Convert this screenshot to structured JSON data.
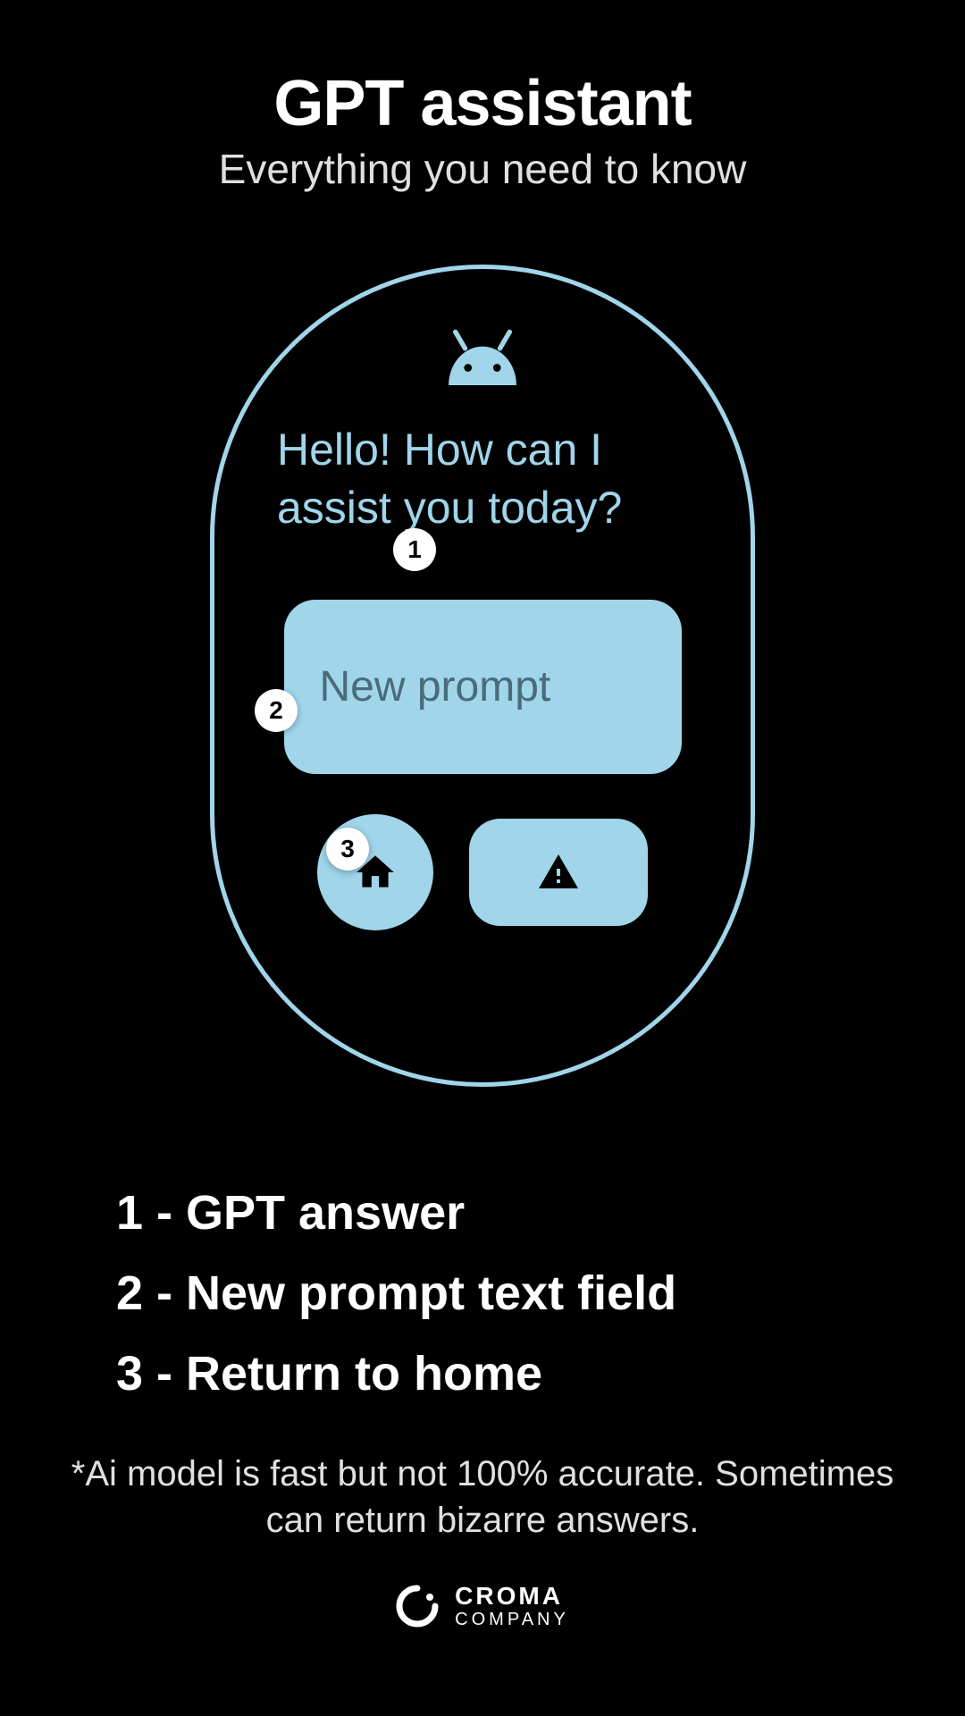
{
  "header": {
    "title": "GPT assistant",
    "subtitle": "Everything you need to know"
  },
  "watch": {
    "answer_text": "Hello! How can I assist you today?",
    "prompt_placeholder": "New prompt"
  },
  "callouts": {
    "one": "1",
    "two": "2",
    "three": "3"
  },
  "legend": {
    "item1": "1 - GPT answer",
    "item2": "2 - New prompt text field",
    "item3": "3 - Return to home"
  },
  "disclaimer": "*Ai model is fast but not 100% accurate. Sometimes can return bizarre answers.",
  "footer": {
    "company_name": "CROMA",
    "company_sub": "COMPANY"
  }
}
